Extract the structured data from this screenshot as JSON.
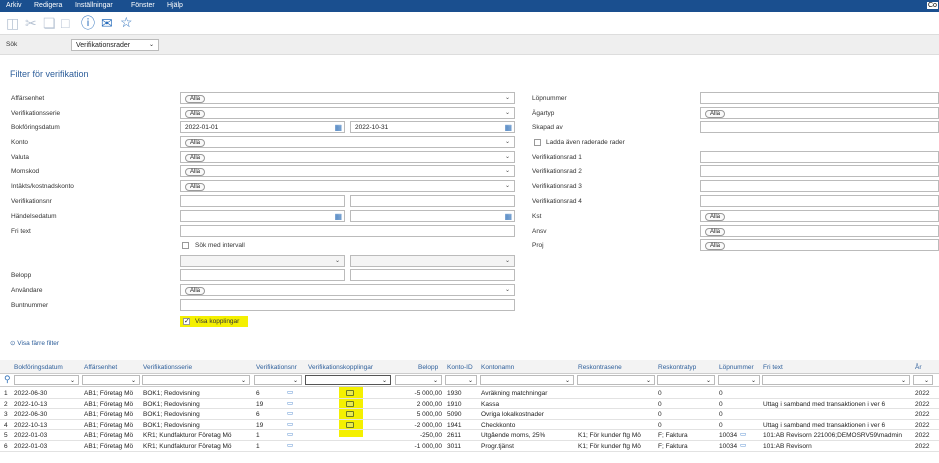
{
  "menu": [
    "Arkiv",
    "Redigera",
    "Inställningar",
    "Fönster",
    "Hjälp"
  ],
  "menu_right": "Co",
  "toolbar_icons": [
    "save-icon",
    "cut-icon",
    "copy-icon",
    "paste-icon",
    "help-icon",
    "comment-icon",
    "star-icon"
  ],
  "search": {
    "label": "Sök",
    "selected": "Verifikationsrader"
  },
  "filter": {
    "title": "Filter för verifikation",
    "left": [
      {
        "label": "Affärsenhet",
        "value": "Alla",
        "type": "select"
      },
      {
        "label": "Verifikationsserie",
        "value": "Alla",
        "type": "select"
      },
      {
        "label": "Bokföringsdatum",
        "from": "2022-01-01",
        "to": "2022-10-31",
        "type": "daterange"
      },
      {
        "label": "Konto",
        "value": "Alla",
        "type": "select"
      },
      {
        "label": "Valuta",
        "value": "Alla",
        "type": "select"
      },
      {
        "label": "Momskod",
        "value": "Alla",
        "type": "select"
      },
      {
        "label": "Intäkts/kostnadskonto",
        "value": "Alla",
        "type": "select"
      },
      {
        "label": "Verifikationsnr",
        "type": "range"
      },
      {
        "label": "Händelsedatum",
        "type": "daterange"
      },
      {
        "label": "Fri text",
        "type": "text"
      }
    ],
    "interval_label": "Sök med intervall",
    "left2": [
      {
        "label": "Belopp",
        "type": "range"
      },
      {
        "label": "Användare",
        "value": "Alla",
        "type": "select"
      },
      {
        "label": "Buntnummer",
        "type": "text"
      }
    ],
    "show_links_label": "Visa kopplingar",
    "right": [
      {
        "label": "Löpnummer",
        "type": "text"
      },
      {
        "label": "Ägartyp",
        "value": "Alla",
        "type": "select"
      },
      {
        "label": "Skapad av",
        "type": "text"
      },
      {
        "label": "Ladda även raderade rader",
        "type": "check"
      },
      {
        "label": "Verifikationsrad 1",
        "type": "text"
      },
      {
        "label": "Verifikationsrad 2",
        "type": "text"
      },
      {
        "label": "Verifikationsrad 3",
        "type": "text"
      },
      {
        "label": "Verifikationsrad 4",
        "type": "text"
      },
      {
        "label": "Kst",
        "value": "Alla",
        "type": "select"
      },
      {
        "label": "Ansv",
        "value": "Alla",
        "type": "select"
      },
      {
        "label": "Proj",
        "value": "Alla",
        "type": "select"
      }
    ],
    "fewer_filters": "Visa färre filter"
  },
  "grid": {
    "headers": [
      "Bokföringsdatum",
      "Affärsenhet",
      "Verifikationsserie",
      "Verifikationsnr",
      "Verifikationskopplingar",
      "Belopp",
      "Konto-ID",
      "Kontonamn",
      "Reskontrasene",
      "Reskontratyp",
      "Löpnummer",
      "Fri text",
      "År"
    ],
    "rows": [
      {
        "n": "1",
        "date": "2022-06-30",
        "ae": "AB1; Företag Mö",
        "ser": "BOK1; Redovisning",
        "nr": "6",
        "link": true,
        "bel": "-5 000,00",
        "kid": "1930",
        "kn": "Avräkning matchningar",
        "res": "",
        "rt": "0",
        "lop": "0",
        "fri": "",
        "ar": "2022"
      },
      {
        "n": "2",
        "date": "2022-10-13",
        "ae": "AB1; Företag Mö",
        "ser": "BOK1; Redovisning",
        "nr": "19",
        "link": true,
        "bel": "2 000,00",
        "kid": "1910",
        "kn": "Kassa",
        "res": "",
        "rt": "0",
        "lop": "0",
        "fri": "Uttag i samband med transaktionen i ver 6",
        "ar": "2022"
      },
      {
        "n": "3",
        "date": "2022-06-30",
        "ae": "AB1; Företag Mö",
        "ser": "BOK1; Redovisning",
        "nr": "6",
        "link": true,
        "bel": "5 000,00",
        "kid": "5090",
        "kn": "Övriga lokalkostnader",
        "res": "",
        "rt": "0",
        "lop": "0",
        "fri": "",
        "ar": "2022"
      },
      {
        "n": "4",
        "date": "2022-10-13",
        "ae": "AB1; Företag Mö",
        "ser": "BOK1; Redovisning",
        "nr": "19",
        "link": true,
        "bel": "-2 000,00",
        "kid": "1941",
        "kn": "Checkkonto",
        "res": "",
        "rt": "0",
        "lop": "0",
        "fri": "Uttag i samband med transaktionen i ver 6",
        "ar": "2022"
      },
      {
        "n": "5",
        "date": "2022-01-03",
        "ae": "AB1; Företag Mö",
        "ser": "KR1; Kundfakturor Företag Mö",
        "nr": "1",
        "link": false,
        "bel": "-250,00",
        "kid": "2611",
        "kn": "Utgående moms, 25%",
        "res": "K1; För kunder ftg Mö",
        "rt": "F; Faktura",
        "lop": "10034",
        "fri": "101:AB Revisorn 221006;DEMOSRV59\\madmin",
        "ar": "2022"
      },
      {
        "n": "6",
        "date": "2022-01-03",
        "ae": "AB1; Företag Mö",
        "ser": "KR1; Kundfakturor Företag Mö",
        "nr": "1",
        "link": false,
        "bel": "-1 000,00",
        "kid": "3011",
        "kn": "Progr.tjänst",
        "res": "K1; För kunder ftg Mö",
        "rt": "F; Faktura",
        "lop": "10034",
        "fri": "101:AB Revisorn",
        "ar": "2022"
      }
    ]
  },
  "colors": {
    "menubar": "#1a4f8f",
    "accent": "#2d5e9a",
    "highlight": "#f4f000"
  }
}
